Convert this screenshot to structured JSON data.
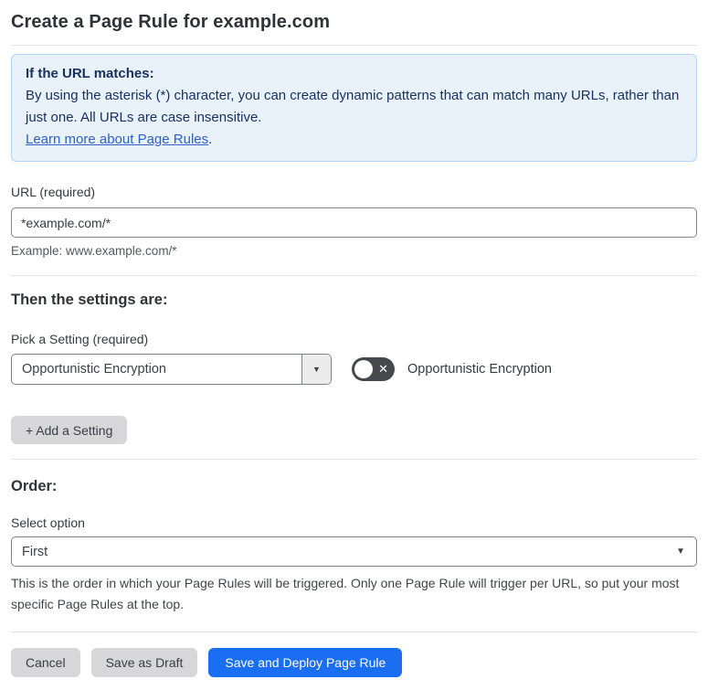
{
  "page": {
    "title": "Create a Page Rule for example.com"
  },
  "info_box": {
    "heading": "If the URL matches:",
    "body": "By using the asterisk (*) character, you can create dynamic patterns that can match many URLs, rather than just one. All URLs are case insensitive.",
    "link_text": "Learn more about Page Rules",
    "link_suffix": "."
  },
  "url_field": {
    "label": "URL (required)",
    "value": "*example.com/*",
    "example": "Example: www.example.com/*"
  },
  "settings": {
    "heading": "Then the settings are:",
    "pick_label": "Pick a Setting (required)",
    "selected_setting": "Opportunistic Encryption",
    "toggle_label": "Opportunistic Encryption",
    "toggle_state": "off",
    "add_button_label": "+ Add a Setting"
  },
  "order": {
    "heading": "Order:",
    "label": "Select option",
    "selected_option": "First",
    "help": "This is the order in which your Page Rules will be triggered. Only one Page Rule will trigger per URL, so put your most specific Page Rules at the top."
  },
  "footer": {
    "cancel_label": "Cancel",
    "save_draft_label": "Save as Draft",
    "save_deploy_label": "Save and Deploy Page Rule"
  },
  "icons": {
    "dropdown_arrow": "▼",
    "toggle_x": "✕"
  },
  "colors": {
    "primary_blue": "#1a6ef2",
    "info_bg": "#e9f1fb",
    "info_border": "#b5d3f2",
    "info_text": "#17305e",
    "link_blue": "#2d62cc",
    "toggle_off_bg": "#46484d",
    "button_gray": "#d7d7d9"
  }
}
